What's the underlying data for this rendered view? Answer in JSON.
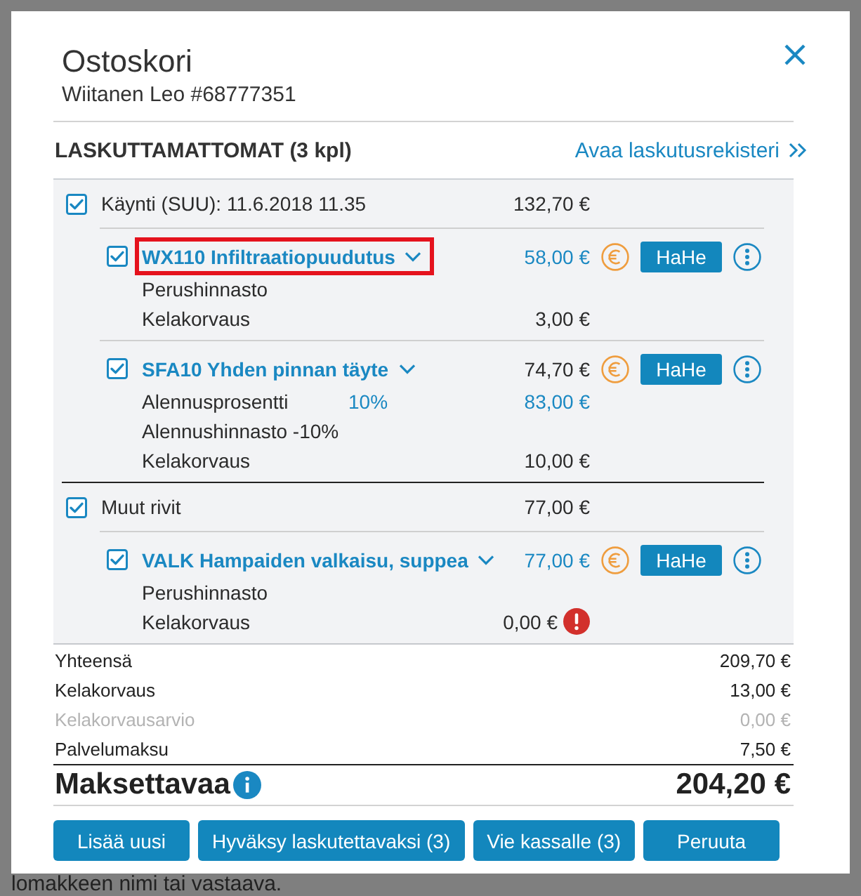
{
  "dialog": {
    "title": "Ostoskori",
    "subtitle": "Wiitanen Leo #68777351"
  },
  "section": {
    "title": "LASKUTTAMATTOMAT (3 kpl)",
    "link": "Avaa laskutusrekisteri"
  },
  "groups": [
    {
      "label": "Käynti (SUU): 11.6.2018 11.35",
      "amount": "132,70 €",
      "checked": true,
      "items": [
        {
          "title": "WX110 Infiltraatiopuudutus",
          "price": "58,00 €",
          "price_highlighted": true,
          "focused": true,
          "checked": true,
          "action": "HaHe",
          "details": [
            {
              "label": "Perushinnasto",
              "warning": false
            },
            {
              "label": "Kelakorvaus",
              "amount": "3,00 €",
              "amount_highlighted": false,
              "warning": false
            }
          ]
        },
        {
          "title": "SFA10 Yhden pinnan täyte",
          "price": "74,70 €",
          "price_highlighted": false,
          "focused": false,
          "checked": true,
          "action": "HaHe",
          "details": [
            {
              "label": "Alennusprosentti",
              "note": "10%",
              "amount": "83,00 €",
              "amount_highlighted": true,
              "warning": false
            },
            {
              "label": "Alennushinnasto -10%",
              "warning": false
            },
            {
              "label": "Kelakorvaus",
              "amount": "10,00 €",
              "amount_highlighted": false,
              "warning": false
            }
          ]
        }
      ]
    },
    {
      "label": "Muut rivit",
      "amount": "77,00 €",
      "checked": true,
      "items": [
        {
          "title": "VALK Hampaiden valkaisu, suppea",
          "price": "77,00 €",
          "price_highlighted": true,
          "focused": false,
          "checked": true,
          "action": "HaHe",
          "details": [
            {
              "label": "Perushinnasto",
              "warning": false
            },
            {
              "label": "Kelakorvaus",
              "amount": "0,00 €",
              "amount_highlighted": false,
              "warning": true
            }
          ]
        }
      ]
    }
  ],
  "totals": [
    {
      "label": "Yhteensä",
      "amount": "209,70 €",
      "muted": false
    },
    {
      "label": "Kelakorvaus",
      "amount": "13,00 €",
      "muted": false
    },
    {
      "label": "Kelakorvausarvio",
      "amount": "0,00 €",
      "muted": true
    },
    {
      "label": "Palvelumaksu",
      "amount": "7,50 €",
      "muted": false
    }
  ],
  "due": {
    "label": "Maksettavaa",
    "amount": "204,20 €"
  },
  "buttons": [
    "Lisää uusi",
    "Hyväksy laskutettavaksi (3)",
    "Vie kassalle (3)",
    "Peruuta"
  ],
  "background_text": "lomakkeen nimi tai vastaava."
}
